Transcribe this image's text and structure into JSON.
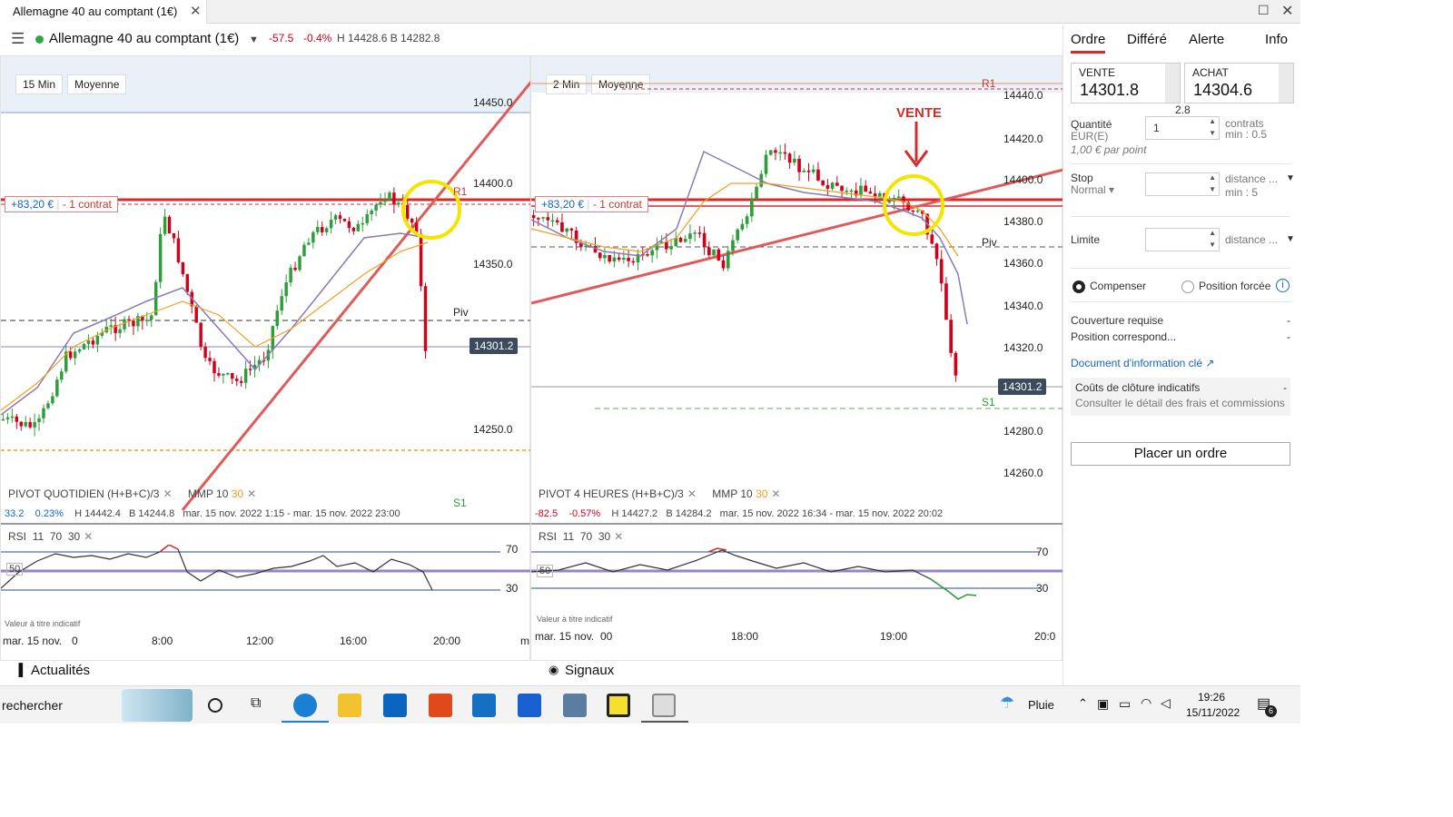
{
  "window": {
    "tab_title": "Allemagne 40 au comptant (1€)",
    "close_glyph": "✕",
    "max_glyph": "☐",
    "menu_glyph": "☰"
  },
  "instrument": {
    "name": "Allemagne 40 au comptant (1€)",
    "change": "-57.5",
    "change_pct": "-0.4%",
    "high_low": "H 14428.6 B 14282.8"
  },
  "chart_left": {
    "timeframe": "15 Min",
    "mode": "Moyenne",
    "y_ticks": [
      "14450.0",
      "14400.0",
      "14350.0",
      "14250.0"
    ],
    "current_price": "14301.2",
    "position_pnl": "+83,20 €",
    "position_qty": "- 1 contrat",
    "pivot_labels": {
      "r1": "R1",
      "piv": "Piv",
      "s1": "S1"
    },
    "indicator_legend": {
      "pivot": "PIVOT  QUOTIDIEN  (H+B+C)/3",
      "mmp": "MMP",
      "mmp_a": "10",
      "mmp_b": "30"
    },
    "info": {
      "chg": "33.2",
      "pct": "0.23%",
      "h": "H 14442.4",
      "b": "B 14244.8",
      "range": "mar. 15 nov. 2022 1:15 - mar. 15 nov. 2022 23:00"
    },
    "rsi_legend": {
      "name": "RSI",
      "a": "11",
      "b": "70",
      "c": "30"
    },
    "rsi_levels": {
      "top": "70",
      "mid": "50",
      "bot": "30"
    },
    "footnote": "Valeur à titre indicatif",
    "x_ticks": [
      "mar. 15 nov.",
      "0",
      "8:00",
      "12:00",
      "16:00",
      "20:00",
      "m"
    ]
  },
  "chart_right": {
    "timeframe": "2 Min",
    "mode": "Moyenne",
    "y_ticks": [
      "14440.0",
      "14420.0",
      "14400.0",
      "14380.0",
      "14360.0",
      "14340.0",
      "14320.0",
      "14280.0",
      "14260.0"
    ],
    "current_price": "14301.2",
    "position_pnl": "+83,20 €",
    "position_qty": "- 1 contrat",
    "annotation": "VENTE",
    "pivot_labels": {
      "r1": "R1",
      "piv": "Piv",
      "s1": "S1"
    },
    "indicator_legend": {
      "pivot": "PIVOT  4 HEURES  (H+B+C)/3",
      "mmp": "MMP",
      "mmp_a": "10",
      "mmp_b": "30"
    },
    "info": {
      "chg": "-82.5",
      "pct": "-0.57%",
      "h": "H 14427.2",
      "b": "B 14284.2",
      "range": "mar. 15 nov. 2022 16:34 - mar. 15 nov. 2022 20:02"
    },
    "rsi_legend": {
      "name": "RSI",
      "a": "11",
      "b": "70",
      "c": "30"
    },
    "rsi_levels": {
      "top": "70",
      "mid": "50",
      "bot": "30"
    },
    "footnote": "Valeur à titre indicatif",
    "x_ticks": [
      "mar. 15 nov.",
      "00",
      "18:00",
      "19:00",
      "20:0"
    ]
  },
  "panels": {
    "news": "Actualités",
    "signals": "Signaux",
    "expand": "»"
  },
  "side": {
    "tabs": [
      "Ordre",
      "Différé",
      "Alerte",
      "Info"
    ],
    "sell_label": "VENTE",
    "sell_price": "14301.8",
    "buy_label": "ACHAT",
    "buy_price": "14304.6",
    "spread": "2.8",
    "qty_label": "Quantité",
    "qty_currency": "EUR(E)",
    "qty_value": "1",
    "qty_unit": "contrats",
    "qty_min": "min : 0.5",
    "per_point": "1,00 € par point",
    "stop_label": "Stop",
    "stop_type": "Normal",
    "stop_distance": "distance ...",
    "stop_min": "min : 5",
    "limit_label": "Limite",
    "limit_distance": "distance ...",
    "compensate": "Compenser",
    "forced": "Position forcée",
    "cover_label": "Couverture requise",
    "cover_value": "-",
    "corresp_label": "Position correspond...",
    "corresp_value": "-",
    "doc_link": "Document d'information clé",
    "cost_title": "Coûts de clôture indicatifs",
    "cost_value": "-",
    "cost_sub": "Consulter le détail des frais et commissions",
    "place_order": "Placer un ordre"
  },
  "taskbar": {
    "search": "rechercher",
    "weather": "Pluie",
    "time": "19:26",
    "date": "15/11/2022",
    "notif_count": "6"
  },
  "colors": {
    "bull": "#2e9e3a",
    "bear": "#d0021b",
    "accent": "#d62b2b",
    "highlight": "#f2e600"
  }
}
